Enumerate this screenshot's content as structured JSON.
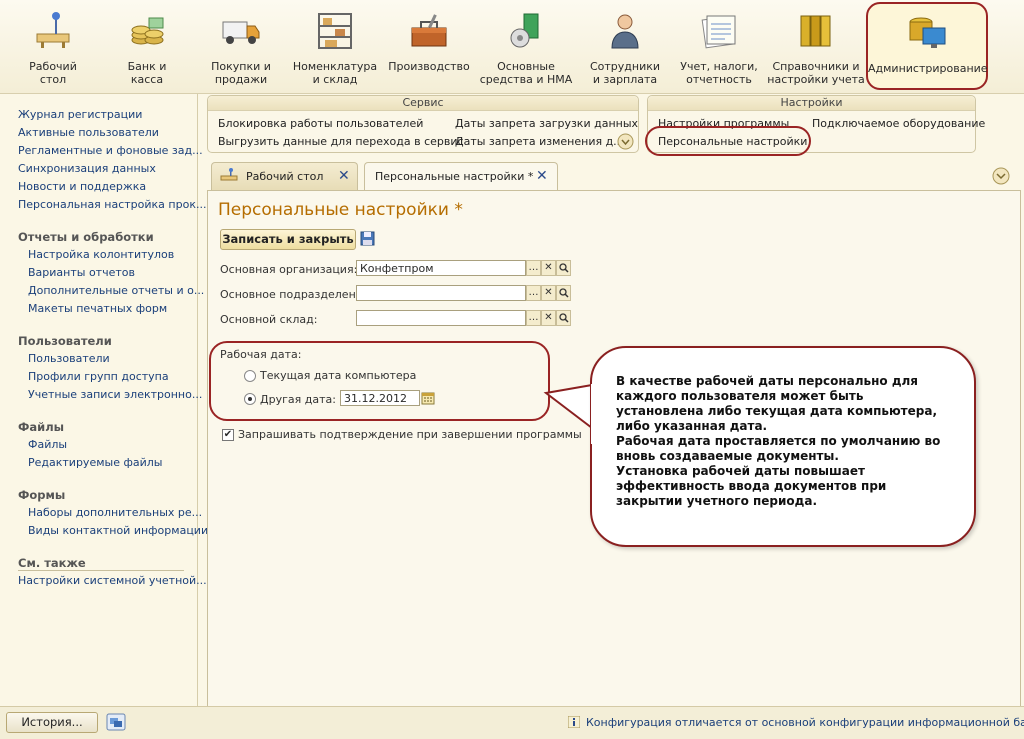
{
  "sections": [
    {
      "label": "Рабочий\nстол",
      "icon": "desk-icon"
    },
    {
      "label": "Банк и\nкасса",
      "icon": "coins-icon"
    },
    {
      "label": "Покупки и\nпродажи",
      "icon": "truck-icon"
    },
    {
      "label": "Номенклатура\nи склад",
      "icon": "shelf-icon"
    },
    {
      "label": "Производство",
      "icon": "toolbox-icon"
    },
    {
      "label": "Основные\nсредства и НМА",
      "icon": "fixed-assets-icon"
    },
    {
      "label": "Сотрудники\nи зарплата",
      "icon": "employee-icon"
    },
    {
      "label": "Учет, налоги,\nотчетность",
      "icon": "ledger-icon"
    },
    {
      "label": "Справочники и\nнастройки учета",
      "icon": "binders-icon"
    },
    {
      "label": "Администрирование",
      "icon": "admin-icon"
    }
  ],
  "left_panel": {
    "links_top": [
      "Журнал регистрации",
      "Активные пользователи",
      "Регламентные и фоновые зад...",
      "Синхронизация данных",
      "Новости и поддержка",
      "Персональная настройка прок..."
    ],
    "group_reports": "Отчеты и обработки",
    "links_reports": [
      "Настройка колонтитулов",
      "Варианты отчетов",
      "Дополнительные отчеты и о...",
      "Макеты печатных форм"
    ],
    "group_users": "Пользователи",
    "links_users": [
      "Пользователи",
      "Профили групп доступа",
      "Учетные записи электронно..."
    ],
    "group_files": "Файлы",
    "links_files": [
      "Файлы",
      "Редактируемые файлы"
    ],
    "group_forms": "Формы",
    "links_forms": [
      "Наборы дополнительных ре...",
      "Виды контактной информации"
    ],
    "group_see_also": "См. также",
    "links_see_also": [
      "Настройки системной учетной..."
    ]
  },
  "service_panel": {
    "title": "Сервис",
    "commands": [
      "Блокировка работы пользователей",
      "Выгрузить данные для перехода в сервис",
      "Даты запрета загрузки данных",
      "Даты запрета изменения д..."
    ]
  },
  "settings_panel": {
    "title": "Настройки",
    "commands": [
      "Настройки программы",
      "Персональные настройки",
      "Подключаемое оборудование"
    ]
  },
  "tabs": [
    {
      "label": "Рабочий стол"
    },
    {
      "label": "Персональные настройки *"
    }
  ],
  "form": {
    "title": "Персональные настройки *",
    "save_close": "Записать и закрыть",
    "org_label": "Основная организация:",
    "org_value": "Конфетпром",
    "dept_label": "Основное подразделение:",
    "dept_value": "",
    "warehouse_label": "Основной склад:",
    "warehouse_value": "",
    "workdate_label": "Рабочая дата:",
    "radio_current": "Текущая дата компьютера",
    "radio_other": "Другая дата:",
    "date_value": "31.12.2012",
    "confirm_exit": "Запрашивать подтверждение при завершении программы"
  },
  "callout_text": "В качестве рабочей даты персонально для каждого пользователя может быть установлена либо текущая дата компьютера, либо указанная дата.\nРабочая дата проставляется по умолчанию во вновь создаваемые документы.\nУстановка рабочей даты повышает эффективность ввода документов при закрытии учетного периода.",
  "status": {
    "history": "История...",
    "message": "Конфигурация отличается от основной конфигурации информационной базы."
  },
  "colors": {
    "accent": "#b56d00",
    "link": "#1a3f7a",
    "highlight": "#9a2424"
  }
}
